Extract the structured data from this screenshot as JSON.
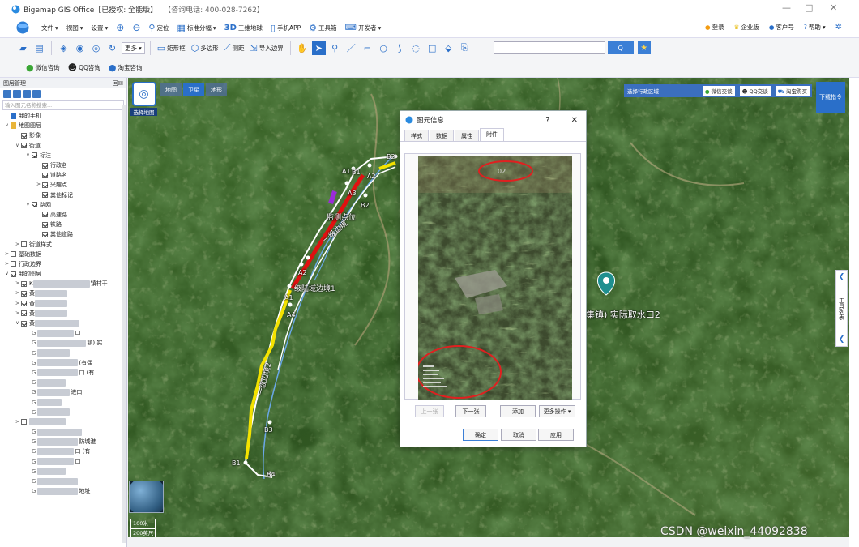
{
  "titlebar": {
    "title": "Bigemap GIS Office【已授权: 全能版】",
    "phone": "【咨询电话: 400-028-7262】",
    "minimize": "—",
    "maximize": "□",
    "close": "✕"
  },
  "menubar": {
    "items": [
      {
        "label": "文件",
        "color": "#3b78c4"
      },
      {
        "label": "视图",
        "color": "#3b78c4"
      },
      {
        "label": "设置",
        "color": "#3b78c4"
      },
      {
        "label": "",
        "color": "#3b78c4"
      },
      {
        "label": "",
        "color": "#3b78c4"
      },
      {
        "label": "定位",
        "color": "#2a6fc9"
      },
      {
        "label": "标准分幅",
        "color": "#2a6fc9"
      },
      {
        "label": "三维地球",
        "color": "#2a6fc9"
      },
      {
        "label": "手机APP",
        "color": "#2a6fc9"
      },
      {
        "label": "工具箱",
        "color": "#2a6fc9"
      },
      {
        "label": "开发者",
        "color": "#2a6fc9"
      }
    ],
    "right": [
      "登录",
      "企业版",
      "客户号",
      "帮助"
    ]
  },
  "toolbar": {
    "more": "更多",
    "rect": "矩形框",
    "poly": "多边形",
    "measure": "测距",
    "import": "导入边界",
    "search_placeholder": "",
    "search_btn": "Q"
  },
  "toolbar2": {
    "wechat": "微信咨询",
    "qq": "QQ咨询",
    "taobao": "淘宝咨询"
  },
  "panel": {
    "title": "图层管理",
    "pin": "回☒",
    "search_placeholder": "输入图元名称搜索...",
    "tree": [
      {
        "indent": 0,
        "arrow": "",
        "check": false,
        "label": "我的手机",
        "icon": "phone"
      },
      {
        "indent": 0,
        "arrow": "∨",
        "check": false,
        "label": "地图图层",
        "icon": "folder"
      },
      {
        "indent": 1,
        "arrow": "",
        "check": true,
        "label": "影像"
      },
      {
        "indent": 1,
        "arrow": "∨",
        "check": true,
        "label": "街道"
      },
      {
        "indent": 2,
        "arrow": "∨",
        "check": true,
        "label": "标注"
      },
      {
        "indent": 3,
        "arrow": "",
        "check": true,
        "label": "行政名"
      },
      {
        "indent": 3,
        "arrow": "",
        "check": true,
        "label": "道路名"
      },
      {
        "indent": 3,
        "arrow": ">",
        "check": true,
        "label": "兴趣点"
      },
      {
        "indent": 3,
        "arrow": "",
        "check": true,
        "label": "其他标记"
      },
      {
        "indent": 2,
        "arrow": "∨",
        "check": true,
        "label": "路网"
      },
      {
        "indent": 3,
        "arrow": "",
        "check": true,
        "label": "高速路"
      },
      {
        "indent": 3,
        "arrow": "",
        "check": true,
        "label": "铁路"
      },
      {
        "indent": 3,
        "arrow": "",
        "check": true,
        "label": "其他道路"
      },
      {
        "indent": 1,
        "arrow": ">",
        "check": false,
        "label": "街道样式"
      },
      {
        "indent": 0,
        "arrow": ">",
        "check": false,
        "label": "基础数据"
      },
      {
        "indent": 0,
        "arrow": ">",
        "check": false,
        "label": "行政边界"
      },
      {
        "indent": 0,
        "arrow": "∨",
        "check": true,
        "label": "我的图层"
      },
      {
        "indent": 1,
        "arrow": ">",
        "check": true,
        "label": "K",
        "blur": 70,
        "tail": "镇村干"
      },
      {
        "indent": 1,
        "arrow": ">",
        "check": true,
        "label": "黄",
        "blur": 40
      },
      {
        "indent": 1,
        "arrow": ">",
        "check": true,
        "label": "黄",
        "blur": 40
      },
      {
        "indent": 1,
        "arrow": ">",
        "check": true,
        "label": "黄",
        "blur": 40
      },
      {
        "indent": 1,
        "arrow": "∨",
        "check": true,
        "label": "黄",
        "blur": 55
      },
      {
        "indent": 2,
        "arrow": "",
        "check": false,
        "label": "",
        "blur": 45,
        "tail": "口"
      },
      {
        "indent": 2,
        "arrow": "",
        "check": false,
        "label": "",
        "blur": 60,
        "tail": "镇) 实"
      },
      {
        "indent": 2,
        "arrow": "",
        "check": false,
        "label": "",
        "blur": 40
      },
      {
        "indent": 2,
        "arrow": "",
        "check": false,
        "label": "",
        "blur": 50,
        "tail": "(有偶"
      },
      {
        "indent": 2,
        "arrow": "",
        "check": false,
        "label": "",
        "blur": 50,
        "tail": "口 (有"
      },
      {
        "indent": 2,
        "arrow": "",
        "check": false,
        "label": "",
        "blur": 35
      },
      {
        "indent": 2,
        "arrow": "",
        "check": false,
        "label": "",
        "blur": 40,
        "tail": "进口"
      },
      {
        "indent": 2,
        "arrow": "",
        "check": false,
        "label": "",
        "blur": 30
      },
      {
        "indent": 2,
        "arrow": "",
        "check": false,
        "label": "",
        "blur": 40
      },
      {
        "indent": 1,
        "arrow": ">",
        "check": false,
        "label": "",
        "blur": 45
      },
      {
        "indent": 2,
        "arrow": "",
        "check": false,
        "label": "",
        "blur": 55
      },
      {
        "indent": 2,
        "arrow": "",
        "check": false,
        "label": "",
        "blur": 50,
        "tail": "防城港"
      },
      {
        "indent": 2,
        "arrow": "",
        "check": false,
        "label": "",
        "blur": 45,
        "tail": "口 (有"
      },
      {
        "indent": 2,
        "arrow": "",
        "check": false,
        "label": "",
        "blur": 45,
        "tail": "口"
      },
      {
        "indent": 2,
        "arrow": "",
        "check": false,
        "label": "",
        "blur": 35
      },
      {
        "indent": 2,
        "arrow": "",
        "check": false,
        "label": "",
        "blur": 50
      },
      {
        "indent": 2,
        "arrow": "",
        "check": false,
        "label": "",
        "blur": 50,
        "tail": "地址"
      }
    ]
  },
  "map": {
    "select_map": "选择地图",
    "tabs": [
      "地图",
      "卫星",
      "地形"
    ],
    "active_tab": 1,
    "region_select": "选择行政区域",
    "wechat": "微信交谈",
    "qq": "QQ交谈",
    "taobao": "淘宝购买",
    "download": "下载指令",
    "tool_list": "工具列表",
    "scale_1": "100米",
    "scale_2": "200英尺",
    "labels": [
      {
        "text": "B2"
      },
      {
        "text": "B1"
      },
      {
        "text": "A2"
      },
      {
        "text": "A1"
      },
      {
        "text": "B2"
      },
      {
        "text": "A3"
      },
      {
        "text": "监测点位"
      },
      {
        "text": "一级边境"
      },
      {
        "text": "A2"
      },
      {
        "text": "级陆域边境1"
      },
      {
        "text": "A1"
      },
      {
        "text": "A4"
      },
      {
        "text": "一级边境2"
      },
      {
        "text": "B3"
      },
      {
        "text": "B1"
      },
      {
        "text": "B4"
      },
      {
        "text": "集镇) 实际取水口2"
      }
    ]
  },
  "dialog": {
    "title": "图元信息",
    "help": "?",
    "close": "✕",
    "tabs": [
      "样式",
      "数据",
      "属性",
      "附件"
    ],
    "active_tab": 3,
    "prev": "上一张",
    "next": "下一张",
    "add": "添加",
    "more": "更多操作 ▾",
    "ok": "确定",
    "cancel": "取消",
    "apply": "应用",
    "photo_text": "02"
  },
  "watermark": "CSDN @weixin_44092838"
}
